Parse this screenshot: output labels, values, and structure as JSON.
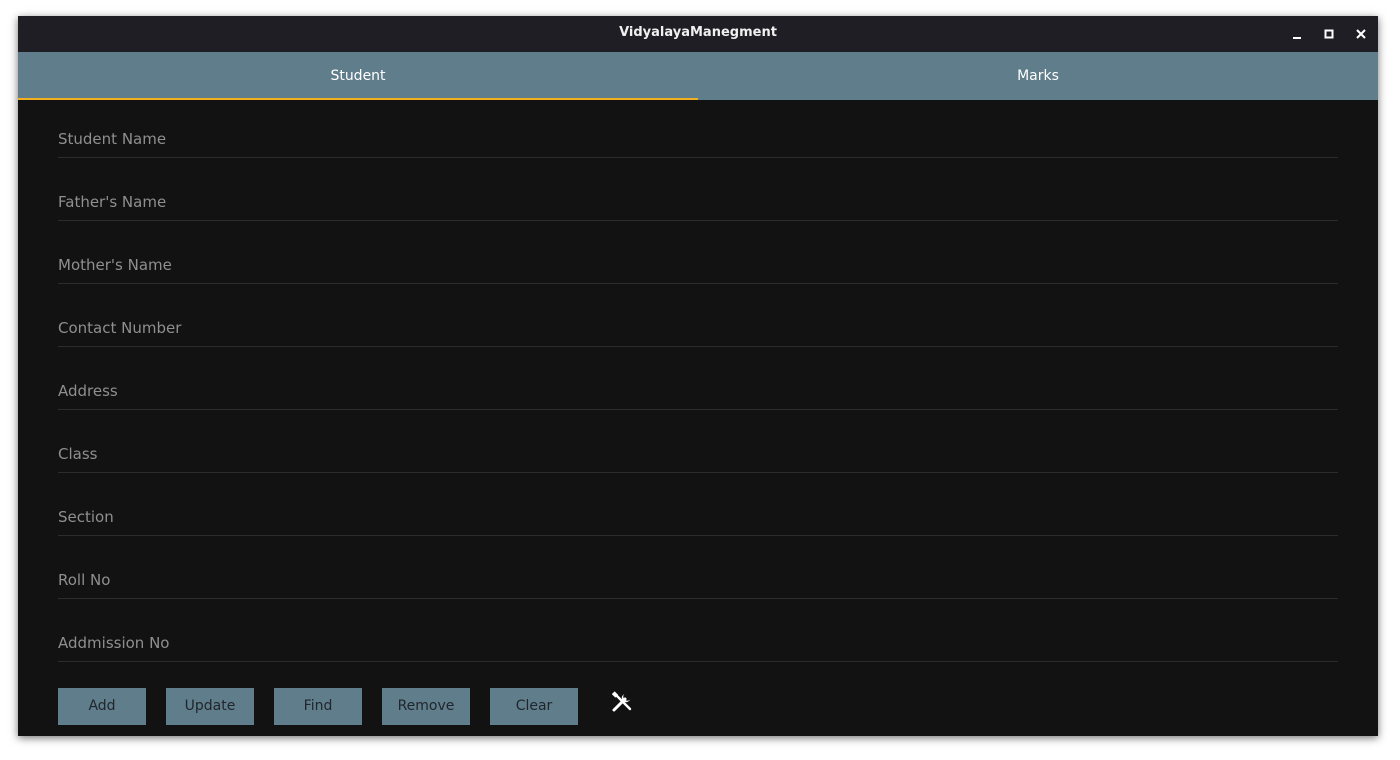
{
  "window": {
    "title": "VidyalayaManegment",
    "controls": [
      "minimize-icon",
      "maximize-icon",
      "close-icon"
    ]
  },
  "tabs": [
    {
      "label": "Student",
      "active": true
    },
    {
      "label": "Marks",
      "active": false
    }
  ],
  "form": {
    "fields": [
      {
        "placeholder": "Student Name",
        "value": ""
      },
      {
        "placeholder": "Father's Name",
        "value": ""
      },
      {
        "placeholder": "Mother's Name",
        "value": ""
      },
      {
        "placeholder": "Contact Number",
        "value": ""
      },
      {
        "placeholder": "Address",
        "value": ""
      },
      {
        "placeholder": "Class",
        "value": ""
      },
      {
        "placeholder": "Section",
        "value": ""
      },
      {
        "placeholder": "Roll No",
        "value": ""
      },
      {
        "placeholder": "Addmission No",
        "value": ""
      }
    ]
  },
  "actions": {
    "add": "Add",
    "update": "Update",
    "find": "Find",
    "remove": "Remove",
    "clear": "Clear",
    "tools_icon": "tools-icon"
  },
  "colors": {
    "accent": "#f2b01e",
    "tab_bar": "#607d8b",
    "background": "#121212",
    "titlebar": "#1e1e24"
  }
}
